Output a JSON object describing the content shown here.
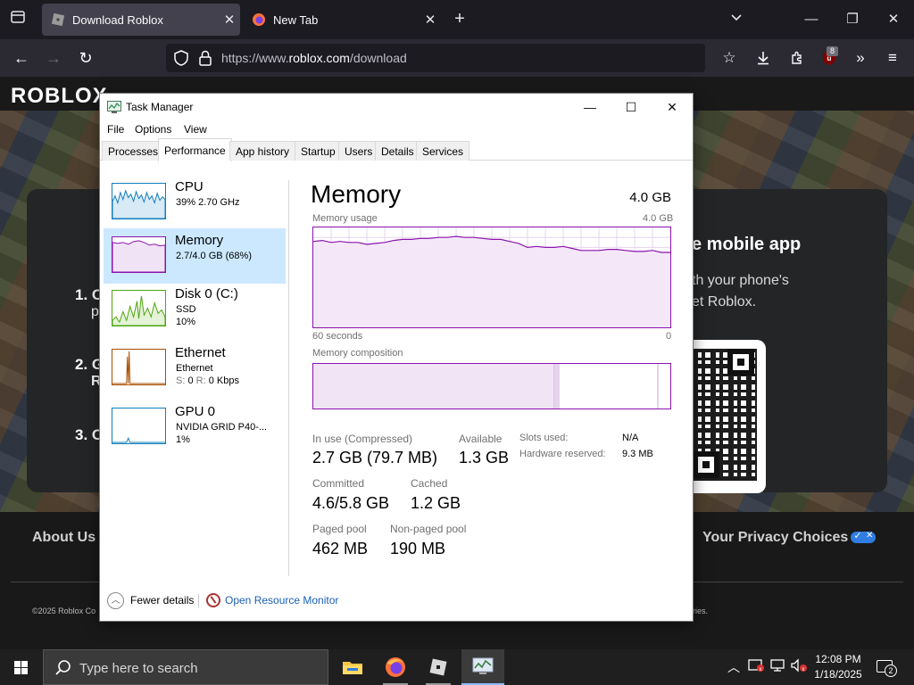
{
  "browser": {
    "tabs": [
      {
        "title": "Download Roblox",
        "active": true
      },
      {
        "title": "New Tab",
        "active": false
      }
    ],
    "url_prefix": "https://www.",
    "url_host": "roblox.com",
    "url_path": "/download",
    "extension_badge": "8"
  },
  "roblox_page": {
    "logo": "ROBLOX",
    "steps": [
      {
        "num": "1.",
        "line1": "C",
        "line2": "p"
      },
      {
        "num": "2.",
        "line1": "G",
        "line2": "R"
      },
      {
        "num": "3.",
        "line1": "C"
      }
    ],
    "mobile_title": "e mobile app",
    "mobile_lines": [
      "th your phone's",
      "et Roblox."
    ],
    "footer_about": "About Us",
    "footer_privacy": "Your Privacy Choices",
    "copyright": "©2025 Roblox Co",
    "copyright_right": "ries."
  },
  "task_manager": {
    "title": "Task Manager",
    "menu": [
      "File",
      "Options",
      "View"
    ],
    "tabs": [
      "Processes",
      "Performance",
      "App history",
      "Startup",
      "Users",
      "Details",
      "Services"
    ],
    "active_tab": "Performance",
    "sidebar": [
      {
        "name": "CPU",
        "line2": "39%  2.70 GHz",
        "color": "#117dbb"
      },
      {
        "name": "Memory",
        "line2": "2.7/4.0 GB (68%)",
        "color": "#8b12ae",
        "selected": true
      },
      {
        "name": "Disk 0 (C:)",
        "line2": "SSD",
        "line3": "10%",
        "color": "#4da60c"
      },
      {
        "name": "Ethernet",
        "line2": "Ethernet",
        "line3_label_s": "S:",
        "line3_val_s": "0",
        "line3_label_r": "R:",
        "line3_val_r": "0 Kbps",
        "color": "#a74f01"
      },
      {
        "name": "GPU 0",
        "line2": "NVIDIA GRID P40-...",
        "line3": "1%",
        "color": "#117dbb"
      }
    ],
    "memory": {
      "heading": "Memory",
      "total": "4.0 GB",
      "usage_label": "Memory usage",
      "usage_max": "4.0 GB",
      "time_left": "60 seconds",
      "time_right": "0",
      "composition_label": "Memory composition",
      "usage_history_fraction": [
        0.86,
        0.87,
        0.85,
        0.86,
        0.85,
        0.85,
        0.83,
        0.84,
        0.85,
        0.87,
        0.88,
        0.88,
        0.89,
        0.89,
        0.9,
        0.9,
        0.91,
        0.9,
        0.9,
        0.89,
        0.88,
        0.88,
        0.86,
        0.84,
        0.8,
        0.81,
        0.8,
        0.8,
        0.81,
        0.79,
        0.77,
        0.77,
        0.77,
        0.78,
        0.78,
        0.77,
        0.76,
        0.76,
        0.77,
        0.75,
        0.75
      ],
      "composition_in_use_fraction": 0.675,
      "composition_modified_fraction": 0.015,
      "composition_standby_fraction": 0.275,
      "in_use_label": "In use (Compressed)",
      "in_use_value": "2.7 GB (79.7 MB)",
      "available_label": "Available",
      "available_value": "1.3 GB",
      "committed_label": "Committed",
      "committed_value": "4.6/5.8 GB",
      "cached_label": "Cached",
      "cached_value": "1.2 GB",
      "paged_label": "Paged pool",
      "paged_value": "462 MB",
      "nonpaged_label": "Non-paged pool",
      "nonpaged_value": "190 MB",
      "slots_label": "Slots used:",
      "slots_value": "N/A",
      "hw_label": "Hardware reserved:",
      "hw_value": "9.3 MB"
    },
    "fewer_details": "Fewer details",
    "open_resource_monitor": "Open Resource Monitor"
  },
  "taskbar": {
    "search_placeholder": "Type here to search",
    "time": "12:08 PM",
    "date": "1/18/2025",
    "notification_count": "2"
  },
  "colors": {
    "memory_accent": "#8b12ae",
    "cpu_accent": "#117dbb",
    "disk_accent": "#4da60c",
    "ethernet_accent": "#a74f01",
    "link_blue": "#1a5fb4"
  }
}
